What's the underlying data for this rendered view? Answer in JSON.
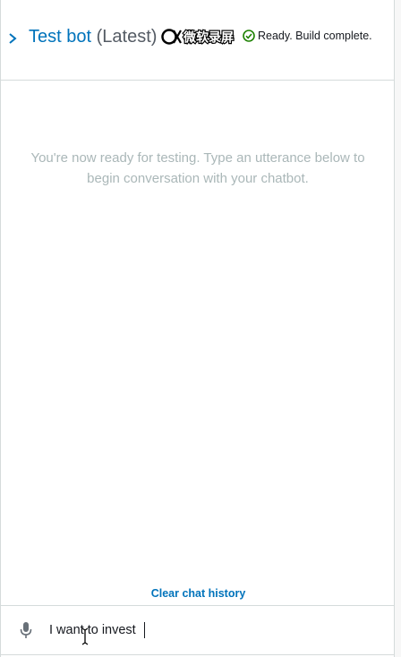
{
  "header": {
    "name": "Test bot",
    "version": "(Latest)",
    "watermark": "微软录屏",
    "status": "Ready. Build complete.",
    "icons": {
      "expand": "chevron-right-icon",
      "status": "check-circle-icon"
    }
  },
  "conversation": {
    "empty_message": "You're now ready for testing. Type an utterance below to begin conversation with your chatbot.",
    "clear_label": "Clear chat history"
  },
  "input": {
    "value": "I want to invest ",
    "icon": "microphone-icon"
  },
  "colors": {
    "link": "#0073bb",
    "success": "#1d8102",
    "muted": "#aab7b8",
    "border": "#d5dbdb"
  }
}
